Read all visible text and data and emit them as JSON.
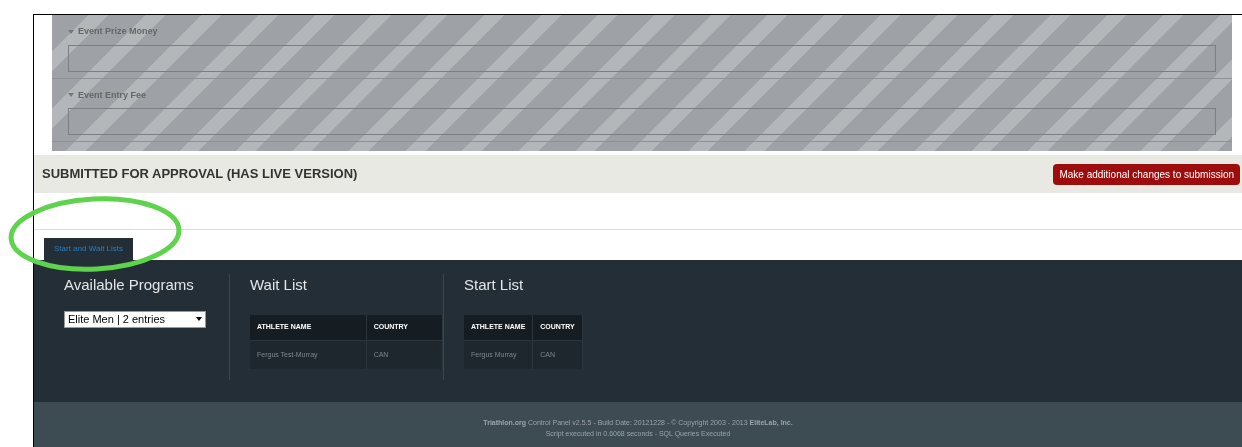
{
  "fields": [
    {
      "label": "Event Prize Money"
    },
    {
      "label": "Event Entry Fee"
    }
  ],
  "status_bar": {
    "text": "SUBMITTED FOR APPROVAL (HAS LIVE VERSION)",
    "button": "Make additional changes to submission"
  },
  "tabs": [
    {
      "label": "Start and Wait Lists",
      "selected": true
    }
  ],
  "programs": {
    "title": "Available Programs",
    "select_value": "Elite Men | 2 entries"
  },
  "lists": [
    {
      "title": "Wait List",
      "columns": [
        "ATHLETE NAME",
        "COUNTRY"
      ],
      "rows": [
        [
          "Fergus Test-Murray",
          "CAN"
        ]
      ]
    },
    {
      "title": "Start List",
      "columns": [
        "ATHLETE NAME",
        "COUNTRY"
      ],
      "rows": [
        [
          "Fergus Murray",
          "CAN"
        ]
      ]
    }
  ],
  "footer": {
    "line1": "**Triathlon.org** Control Panel v2.5.5 - Build Date: 20121228 - © Copyright 2003 - 2013 **EliteLab, Inc.**",
    "line2": "Script executed in 0.6068 seconds - SQL Queries Executed"
  }
}
